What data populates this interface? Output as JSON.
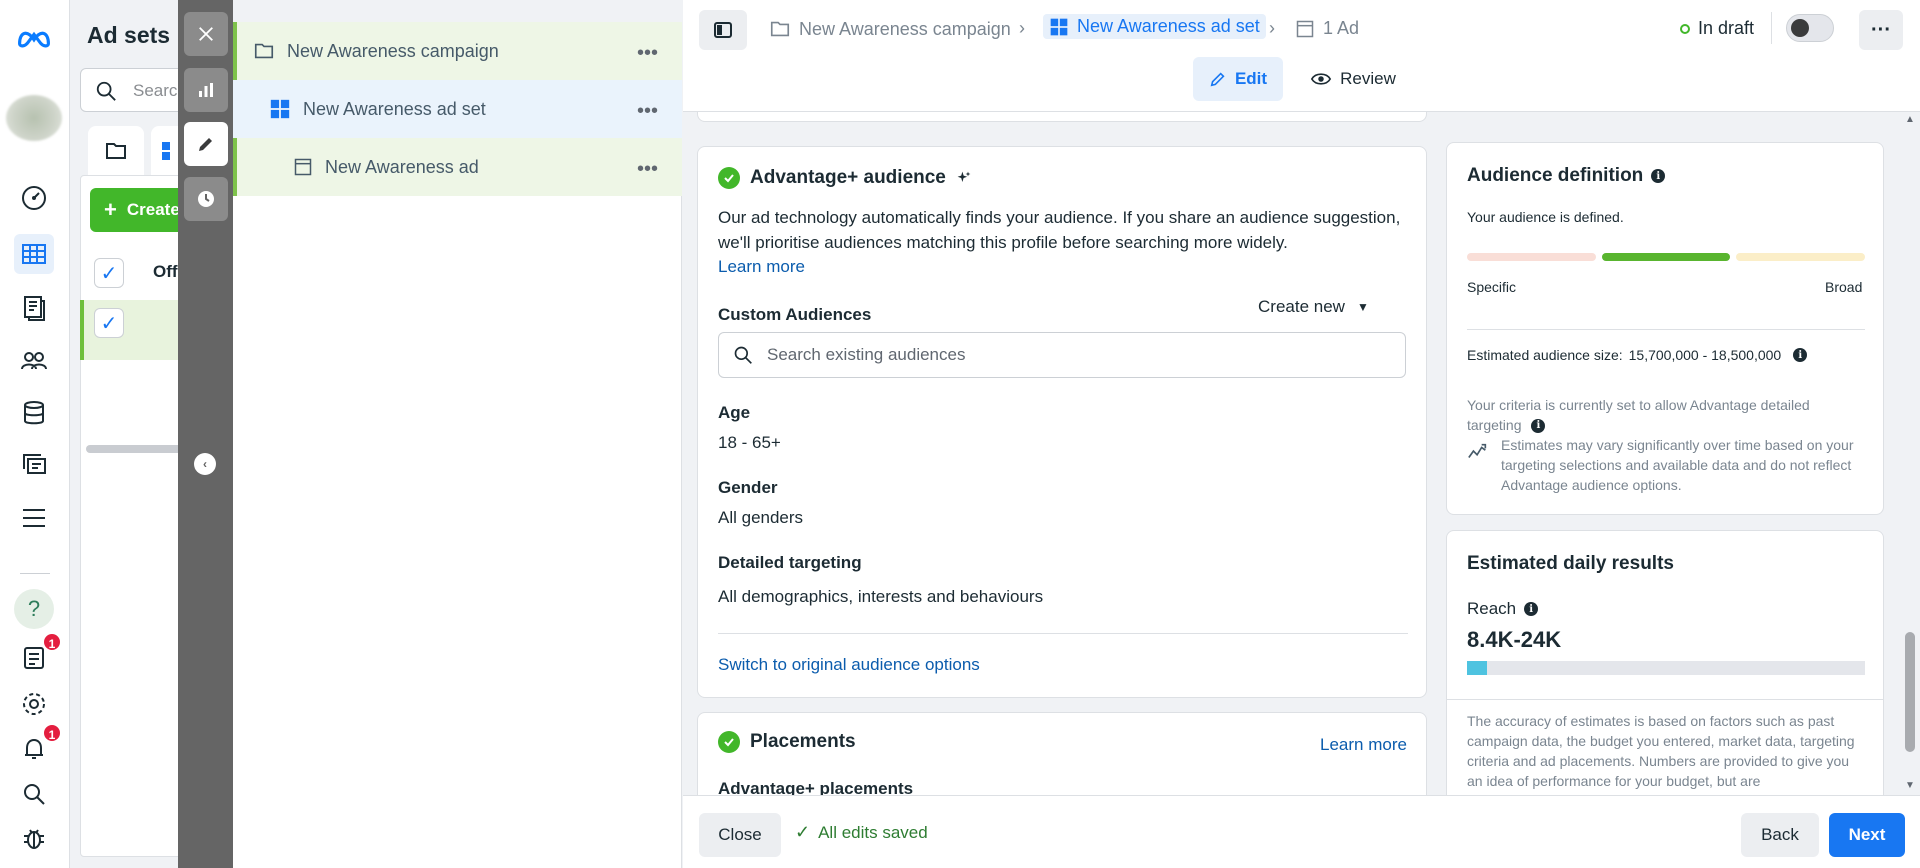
{
  "adsets_panel": {
    "title": "Ad sets",
    "search_placeholder": "Search",
    "create_label": "Create",
    "column_header": "Off"
  },
  "tree": {
    "campaign": "New Awareness campaign",
    "adset": "New Awareness ad set",
    "ad": "New Awareness ad"
  },
  "topbar": {
    "breadcrumb_campaign": "New Awareness campaign",
    "breadcrumb_adset": "New Awareness ad set",
    "breadcrumb_ad": "1 Ad",
    "status": "In draft",
    "tab_edit": "Edit",
    "tab_review": "Review"
  },
  "audience": {
    "title": "Advantage+ audience",
    "description": "Our ad technology automatically finds your audience. If you share an audience suggestion, we'll prioritise audiences matching this profile before searching more widely.",
    "learn_more": "Learn more",
    "custom_audiences_label": "Custom Audiences",
    "create_new": "Create new",
    "search_placeholder": "Search existing audiences",
    "age_label": "Age",
    "age_value": "18 - 65+",
    "gender_label": "Gender",
    "gender_value": "All genders",
    "detailed_label": "Detailed targeting",
    "detailed_value": "All demographics, interests and behaviours",
    "switch_link": "Switch to original audience options"
  },
  "placements": {
    "title": "Placements",
    "learn_more": "Learn more",
    "sub_label": "Advantage+ placements"
  },
  "audience_definition": {
    "title": "Audience definition",
    "status": "Your audience is defined.",
    "specific": "Specific",
    "broad": "Broad",
    "size_label": "Estimated audience size:",
    "size_value": "15,700,000 - 18,500,000",
    "criteria_note": "Your criteria is currently set to allow Advantage detailed targeting",
    "estimates_note": "Estimates may vary significantly over time based on your targeting selections and available data and do not reflect Advantage audience options."
  },
  "daily_results": {
    "title": "Estimated daily results",
    "reach_label": "Reach",
    "reach_value": "8.4K-24K",
    "reach_fill_percent": 5,
    "accuracy_note": "The accuracy of estimates is based on factors such as past campaign data, the budget you entered, market data, targeting criteria and ad placements. Numbers are provided to give you an idea of performance for your budget, but are"
  },
  "bottom": {
    "close": "Close",
    "saved": "All edits saved",
    "back": "Back",
    "next": "Next"
  },
  "badges": {
    "notifications_a": "1",
    "notifications_b": "1"
  },
  "colors": {
    "brand_blue": "#1877f2",
    "success_green": "#42b72a",
    "alert_red": "#e41e3f"
  }
}
